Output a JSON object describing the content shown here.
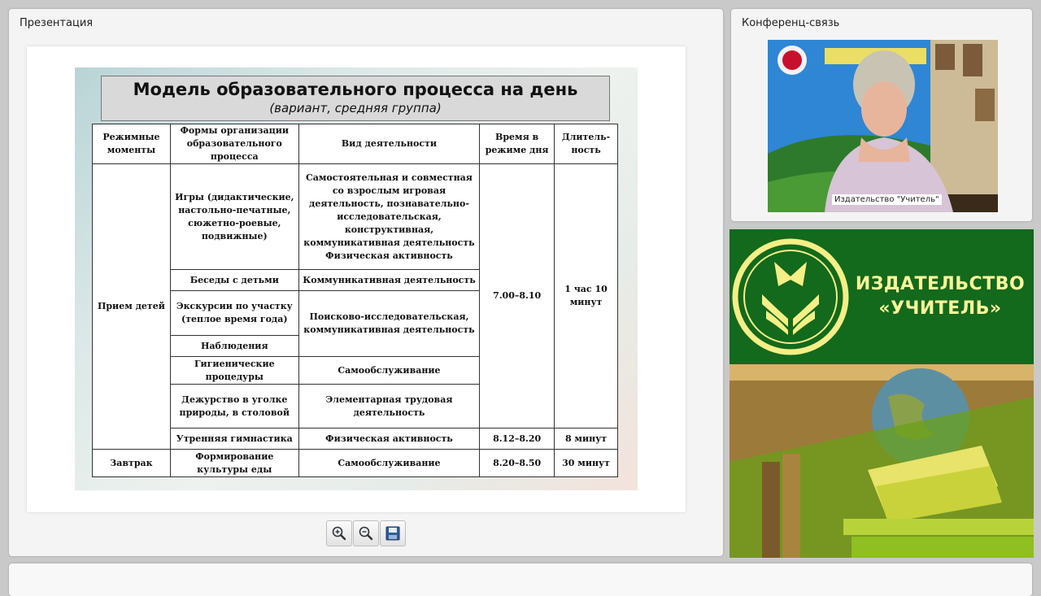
{
  "presentation": {
    "panel_title": "Презентация",
    "slide": {
      "title": "Модель образовательного процесса на день",
      "subtitle": "(вариант, средняя группа)",
      "headers": [
        "Режимные моменты",
        "Формы организации образовательного процесса",
        "Вид деятельности",
        "Время в режиме дня",
        "Длитель-ность"
      ],
      "rows": {
        "priem": "Прием детей",
        "igry": "Игры (дидактические, настольно-печатные, сюжетно-роевые, подвижные)",
        "igry_vid": "Самостоятельная и совместная со взрослым игровая деятельность, познавательно-исследовательская, конструктивная, коммуникативная деятельность Физическая активность",
        "time1": "7.00–8.10",
        "dur1": "1 час 10 минут",
        "besedy": "Беседы с детьми",
        "besedy_vid": "Коммуникативная  деятельность",
        "ekskursii": "Экскурсии по участку (теплое время года)",
        "poisk_vid": "Поисково-исследовательская, коммуникативная деятельность",
        "nabl": "Наблюдения",
        "gigiena": "Гигиенические процедуры",
        "samoobsl": "Самообслуживание",
        "dezhurstvo": "Дежурство в уголке природы, в столовой",
        "trud_vid": "Элементарная трудовая деятельность",
        "gimn": "Утренняя гимнастика",
        "fiz_vid": "Физическая активность",
        "time2": "8.12–8.20",
        "dur2": "8 минут",
        "zavtrak": "Завтрак",
        "kultura": "Формирование культуры еды",
        "samoobsl2": "Самообслуживание",
        "time3": "8.20–8.50",
        "dur3": "30 минут"
      }
    },
    "toolbar": {
      "zoom_in": "zoom-in-icon",
      "zoom_out": "zoom-out-icon",
      "save": "save-icon"
    }
  },
  "conference": {
    "panel_title": "Конференц-связь",
    "caption": "Издательство \"Учитель\""
  },
  "publisher": {
    "line1": "ИЗДАТЕЛЬСТВО",
    "line2": "«УЧИТЕЛЬ»"
  },
  "colors": {
    "brand_green": "#13691c",
    "brand_yellow": "#fff59a"
  }
}
